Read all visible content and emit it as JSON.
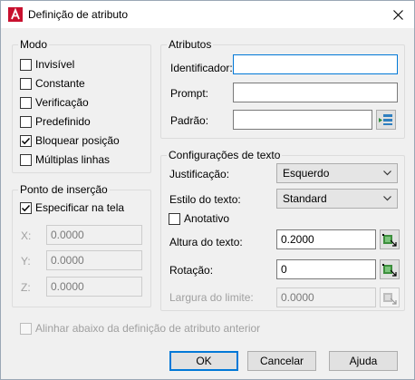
{
  "window": {
    "title": "Definição de atributo",
    "close": "✕"
  },
  "mode": {
    "title": "Modo",
    "options": [
      {
        "label": "Invisível",
        "checked": false
      },
      {
        "label": "Constante",
        "checked": false
      },
      {
        "label": "Verificação",
        "checked": false
      },
      {
        "label": "Predefinido",
        "checked": false
      },
      {
        "label": "Bloquear posição",
        "checked": true
      },
      {
        "label": "Múltiplas linhas",
        "checked": false
      }
    ]
  },
  "insertion": {
    "title": "Ponto de inserção",
    "specify_label": "Especificar na tela",
    "specify_checked": true,
    "x_label": "X:",
    "x_value": "0.0000",
    "y_label": "Y:",
    "y_value": "0.0000",
    "z_label": "Z:",
    "z_value": "0.0000"
  },
  "attributes": {
    "title": "Atributos",
    "tag_label": "Identificador:",
    "tag_value": "",
    "prompt_label": "Prompt:",
    "prompt_value": "",
    "default_label": "Padrão:",
    "default_value": ""
  },
  "text_settings": {
    "title": "Configurações de texto",
    "justification_label": "Justificação:",
    "justification_value": "Esquerdo",
    "style_label": "Estilo do texto:",
    "style_value": "Standard",
    "annotative_label": "Anotativo",
    "annotative_checked": false,
    "height_label": "Altura do texto:",
    "height_value": "0.2000",
    "rotation_label": "Rotação:",
    "rotation_value": "0",
    "boundary_label": "Largura do limite:",
    "boundary_value": "0.0000"
  },
  "align_below": {
    "label": "Alinhar abaixo da definição de atributo anterior",
    "checked": false
  },
  "buttons": {
    "ok": "OK",
    "cancel": "Cancelar",
    "help": "Ajuda"
  }
}
